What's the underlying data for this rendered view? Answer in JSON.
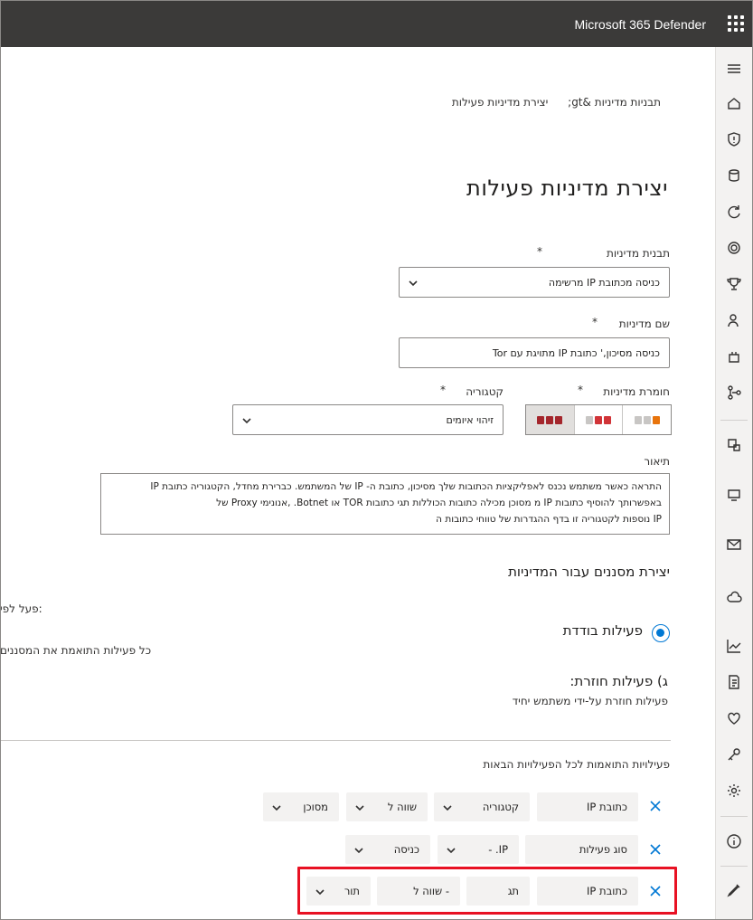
{
  "header": {
    "app_title": "Microsoft 365 Defender"
  },
  "breadcrumb": {
    "item1": "תבניות מדיניות &gt;",
    "item2": "יצירת מדיניות פעילות"
  },
  "page_title": "יצירת מדיניות פעילות",
  "form": {
    "template_label": "תבנית מדיניות",
    "template_value": "כניסה מכתובת IP מרשימה",
    "name_label": "שם מדיניות",
    "name_value": "כניסה מסיכון,' כתובת IP מתויגת עם Tor",
    "severity_label": "חומרת מדיניות",
    "category_label": "קטגוריה",
    "category_value": "זיהוי איומים",
    "description_label": "תיאור",
    "description_lines": [
      "התראה כאשר משתמש נכנס לאפליקציות הכתובות שלך מסיכון, כתובת ה- IP של המשתמש. כברירת מחדל, הקטגוריה כתובת IP",
      "באפשרותך להוסיף כתובות  IP מ מסוכן מכילה כתובות הכוללות תגי כתובות TOR או Botnet. ,אנונימי Proxy של",
      "IP נוספות לקטגוריה זו בדף ההגדרות של טווחי כתובות ה"
    ],
    "required_mark": "*"
  },
  "filters": {
    "section_title": "יצירת מסננים עבור המדיניות",
    "act_on_label": "פעל לפי:",
    "single_activity_label": "פעילות בודדת",
    "single_activity_desc": "כל פעילות התואמת את המסננים",
    "repeated_activity_label": "ג) פעילות חוזרת:",
    "repeated_activity_desc": "פעילות חוזרת על-ידי משתמש יחיד",
    "match_label": "פעילויות התואמות לכל הפעילויות הבאות",
    "rows": [
      {
        "field": "כתובת IP",
        "sub": "קטגוריה",
        "op": "שווה ל",
        "value": "מסוכן"
      },
      {
        "field": "סוג פעילות",
        "op": "IP. -",
        "value": "כניסה"
      },
      {
        "field": "כתובת IP",
        "sub": "תג",
        "op": "- שווה ל",
        "value": "תור"
      }
    ]
  },
  "colors": {
    "accent": "#0078d4",
    "highlight": "#e81123",
    "topbar": "#3b3a39"
  },
  "rail_icons": [
    "hamburger-icon",
    "home-icon",
    "shield-icon",
    "incidents-icon",
    "hunting-icon",
    "threat-analytics-icon",
    "trophy-icon",
    "partners-icon",
    "evaluation-icon",
    "connectors-icon",
    "assets-icon",
    "devices-icon",
    "email-icon",
    "cloud-icon",
    "reports-icon",
    "audit-icon",
    "health-icon",
    "permissions-icon",
    "settings-icon",
    "info-icon",
    "customize-icon"
  ]
}
